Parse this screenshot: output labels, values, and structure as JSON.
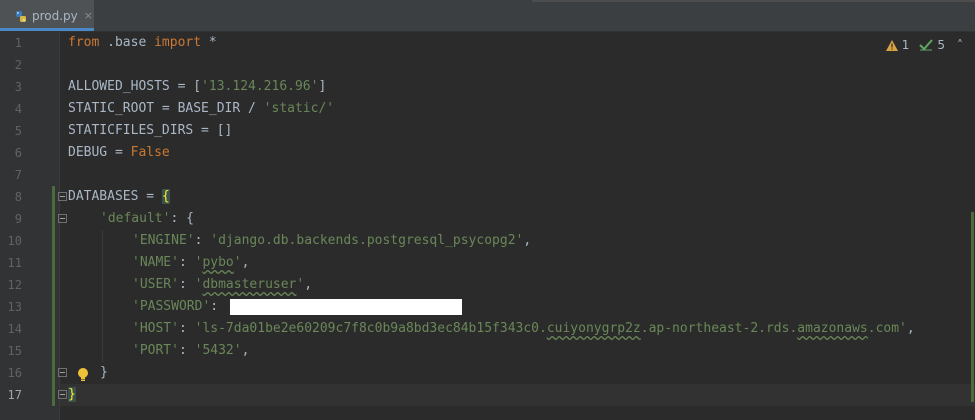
{
  "tab": {
    "filename": "prod.py",
    "close_glyph": "×"
  },
  "inspections": {
    "warnings": "1",
    "typos": "5",
    "warning_icon": "warning-triangle-icon",
    "typo_icon": "spellcheck-icon",
    "chevron": "˄"
  },
  "lines": [
    {
      "n": "1"
    },
    {
      "n": "2"
    },
    {
      "n": "3"
    },
    {
      "n": "4"
    },
    {
      "n": "5"
    },
    {
      "n": "6"
    },
    {
      "n": "7"
    },
    {
      "n": "8"
    },
    {
      "n": "9"
    },
    {
      "n": "10"
    },
    {
      "n": "11"
    },
    {
      "n": "12"
    },
    {
      "n": "13"
    },
    {
      "n": "14"
    },
    {
      "n": "15"
    },
    {
      "n": "16"
    },
    {
      "n": "17"
    }
  ],
  "code": {
    "l1_from": "from",
    "l1_mod": " .base ",
    "l1_import": "import",
    "l1_star": " *",
    "l3_a": "ALLOWED_HOSTS = [",
    "l3_str": "'13.124.216.96'",
    "l3_b": "]",
    "l4_a": "STATIC_ROOT = BASE_DIR / ",
    "l4_str": "'static/'",
    "l5": "STATICFILES_DIRS = []",
    "l6_a": "DEBUG = ",
    "l6_kw": "False",
    "l8_a": "DATABASES = ",
    "l8_brace": "{",
    "l9_str": "'default'",
    "l9_b": ": {",
    "l10_key": "'ENGINE'",
    "l10_val": "'django.db.backends.postgresql_psycopg2'",
    "l11_key": "'NAME'",
    "l11_val_q1": "'",
    "l11_val_word": "pybo",
    "l11_val_q2": "'",
    "l12_key": "'USER'",
    "l12_val_q1": "'",
    "l12_val_word": "dbmasteruser",
    "l12_val_q2": "'",
    "l13_key": "'PASSWORD'",
    "l14_key": "'HOST'",
    "l14_v1": "'ls-7da01be2e60209c7f8c0b9a8bd3ec84b15f343c0.",
    "l14_v2": "cuiyonygrp2z",
    "l14_v3": ".ap-northeast-2.rds.",
    "l14_v4": "amazonaws",
    "l14_v5": ".com'",
    "l15_key": "'PORT'",
    "l15_val": "'5432'",
    "l16": "}",
    "l17_brace": "}",
    "colon": ": ",
    "comma": ","
  },
  "colors": {
    "keyword": "#cc7832",
    "string": "#6a8759",
    "text": "#a9b7c6",
    "background": "#2b2b2b",
    "gutter": "#313335"
  }
}
